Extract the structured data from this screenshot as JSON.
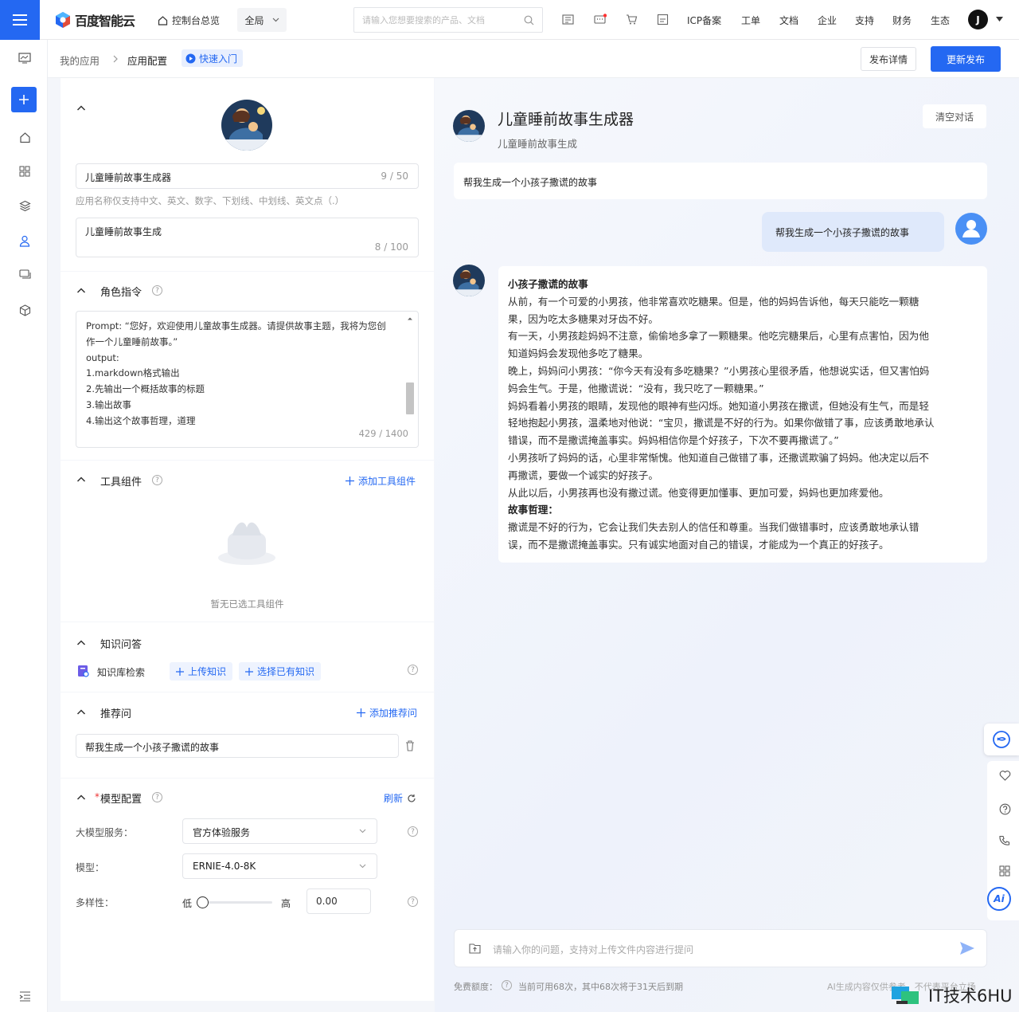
{
  "topbar": {
    "logo_text": "百度智能云",
    "console_label": "控制台总览",
    "region_label": "全局",
    "search_placeholder": "请输入您想要搜索的产品、文档",
    "nav_items": [
      "ICP备案",
      "工单",
      "文档",
      "企业",
      "支持",
      "财务",
      "生态"
    ],
    "user_initial": "J"
  },
  "breadcrumb": {
    "item1": "我的应用",
    "item2": "应用配置",
    "quick_start": "快速入门",
    "publish_detail": "发布详情",
    "update_publish": "更新发布"
  },
  "basic": {
    "app_name": "儿童睡前故事生成器",
    "app_name_count": "9 / 50",
    "app_name_hint": "应用名称仅支持中文、英文、数字、下划线、中划线、英文点（.）",
    "app_desc": "儿童睡前故事生成",
    "app_desc_count": "8 / 100"
  },
  "role": {
    "title": "角色指令",
    "lines": [
      "Prompt: “您好，欢迎使用儿童故事生成器。请提供故事主题，我将为您创",
      "作一个儿童睡前故事。”",
      "output:",
      "1.markdown格式输出",
      "2.先输出一个概括故事的标题",
      "3.输出故事",
      "4.输出这个故事哲理，道理"
    ],
    "count": "429 / 1400"
  },
  "tools": {
    "title": "工具组件",
    "add_label": "添加工具组件",
    "empty_text": "暂无已选工具组件"
  },
  "knowledge": {
    "title": "知识问答",
    "item_label": "知识库检索",
    "upload_label": "上传知识",
    "select_label": "选择已有知识"
  },
  "recommend": {
    "title": "推荐问",
    "add_label": "添加推荐问",
    "question": "帮我生成一个小孩子撒谎的故事"
  },
  "model": {
    "title": "模型配置",
    "required_mark": "*",
    "refresh_label": "刷新",
    "service_label": "大模型服务：",
    "service_value": "官方体验服务",
    "model_label": "模型：",
    "model_value": "ERNIE-4.0-8K",
    "diversity_label": "多样性：",
    "low_label": "低",
    "high_label": "高",
    "diversity_value": "0.00",
    "diversity_level": 0.0
  },
  "chat": {
    "title": "儿童睡前故事生成器",
    "subtitle": "儿童睡前故事生成",
    "clear_label": "清空对话",
    "suggestion": "帮我生成一个小孩子撒谎的故事",
    "user_message": "帮我生成一个小孩子撒谎的故事",
    "reply_title": "小孩子撒谎的故事",
    "reply_lines": [
      "从前，有一个可爱的小男孩，他非常喜欢吃糖果。但是，他的妈妈告诉他，每天只能吃一颗糖",
      "果，因为吃太多糖果对牙齿不好。",
      "有一天，小男孩趁妈妈不注意，偷偷地多拿了一颗糖果。他吃完糖果后，心里有点害怕，因为他",
      "知道妈妈会发现他多吃了糖果。",
      "晚上，妈妈问小男孩：“你今天有没有多吃糖果？”小男孩心里很矛盾，他想说实话，但又害怕妈",
      "妈会生气。于是，他撒谎说：“没有，我只吃了一颗糖果。”",
      "妈妈看着小男孩的眼睛，发现他的眼神有些闪烁。她知道小男孩在撒谎，但她没有生气，而是轻",
      "轻地抱起小男孩，温柔地对他说：“宝贝，撒谎是不好的行为。如果你做错了事，应该勇敢地承认",
      "错误，而不是撒谎掩盖事实。妈妈相信你是个好孩子，下次不要再撒谎了。”",
      "小男孩听了妈妈的话，心里非常惭愧。他知道自己做错了事，还撒谎欺骗了妈妈。他决定以后不",
      "再撒谎，要做一个诚实的好孩子。",
      "从此以后，小男孩再也没有撒过谎。他变得更加懂事、更加可爱，妈妈也更加疼爱他。"
    ],
    "moral_title": "故事哲理：",
    "moral_lines": [
      "撒谎是不好的行为，它会让我们失去别人的信任和尊重。当我们做错事时，应该勇敢地承认错",
      "误，而不是撒谎掩盖事实。只有诚实地面对自己的错误，才能成为一个真正的好孩子。"
    ],
    "input_placeholder": "请输入你的问题，支持对上传文件内容进行提问",
    "quota_label": "免费额度：",
    "quota_text": "当前可用68次，其中68次将于31天后到期",
    "ai_notice": "AI生成内容仅供参考，不代表平台立场"
  },
  "watermark": "IT技术6HU",
  "colors": {
    "brand": "#2468f2",
    "bg": "#f4f6fa"
  }
}
